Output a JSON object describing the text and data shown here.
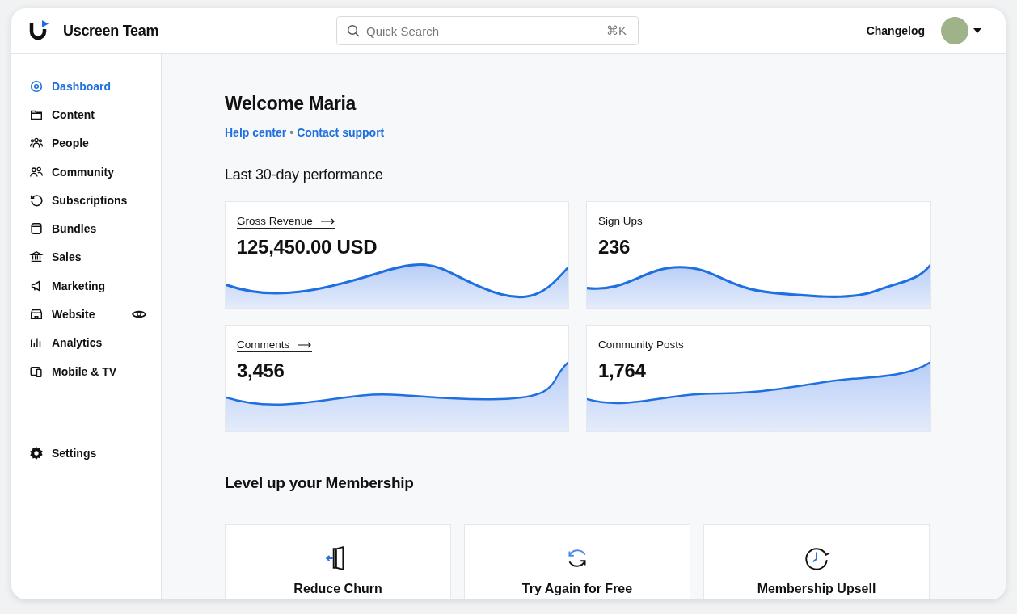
{
  "brand": {
    "name": "Uscreen Team"
  },
  "search": {
    "placeholder": "Quick Search",
    "shortcut": "⌘K"
  },
  "header": {
    "changelog": "Changelog"
  },
  "sidebar": {
    "items": [
      {
        "label": "Dashboard",
        "selected": true
      },
      {
        "label": "Content",
        "selected": false
      },
      {
        "label": "People",
        "selected": false
      },
      {
        "label": "Community",
        "selected": false
      },
      {
        "label": "Subscriptions",
        "selected": false
      },
      {
        "label": "Bundles",
        "selected": false
      },
      {
        "label": "Sales",
        "selected": false
      },
      {
        "label": "Marketing",
        "selected": false
      },
      {
        "label": "Website",
        "selected": false,
        "preview": true
      },
      {
        "label": "Analytics",
        "selected": false
      },
      {
        "label": "Mobile & TV",
        "selected": false
      }
    ],
    "settings": {
      "label": "Settings",
      "selected": false
    }
  },
  "welcome": {
    "title": "Welcome Maria",
    "links": [
      "Help center",
      "Contact support"
    ],
    "separator": "•"
  },
  "performance": {
    "title": "Last 30-day performance",
    "cards": [
      {
        "label": "Gross Revenue",
        "value": "125,450.00 USD",
        "link": true
      },
      {
        "label": "Sign Ups",
        "value": "236",
        "link": false
      },
      {
        "label": "Comments",
        "value": "3,456",
        "link": true
      },
      {
        "label": "Community Posts",
        "value": "1,764",
        "link": false
      }
    ]
  },
  "membership": {
    "title": "Level up your Membership",
    "cards": [
      {
        "title": "Reduce Churn"
      },
      {
        "title": "Try Again for Free"
      },
      {
        "title": "Membership Upsell"
      }
    ]
  }
}
